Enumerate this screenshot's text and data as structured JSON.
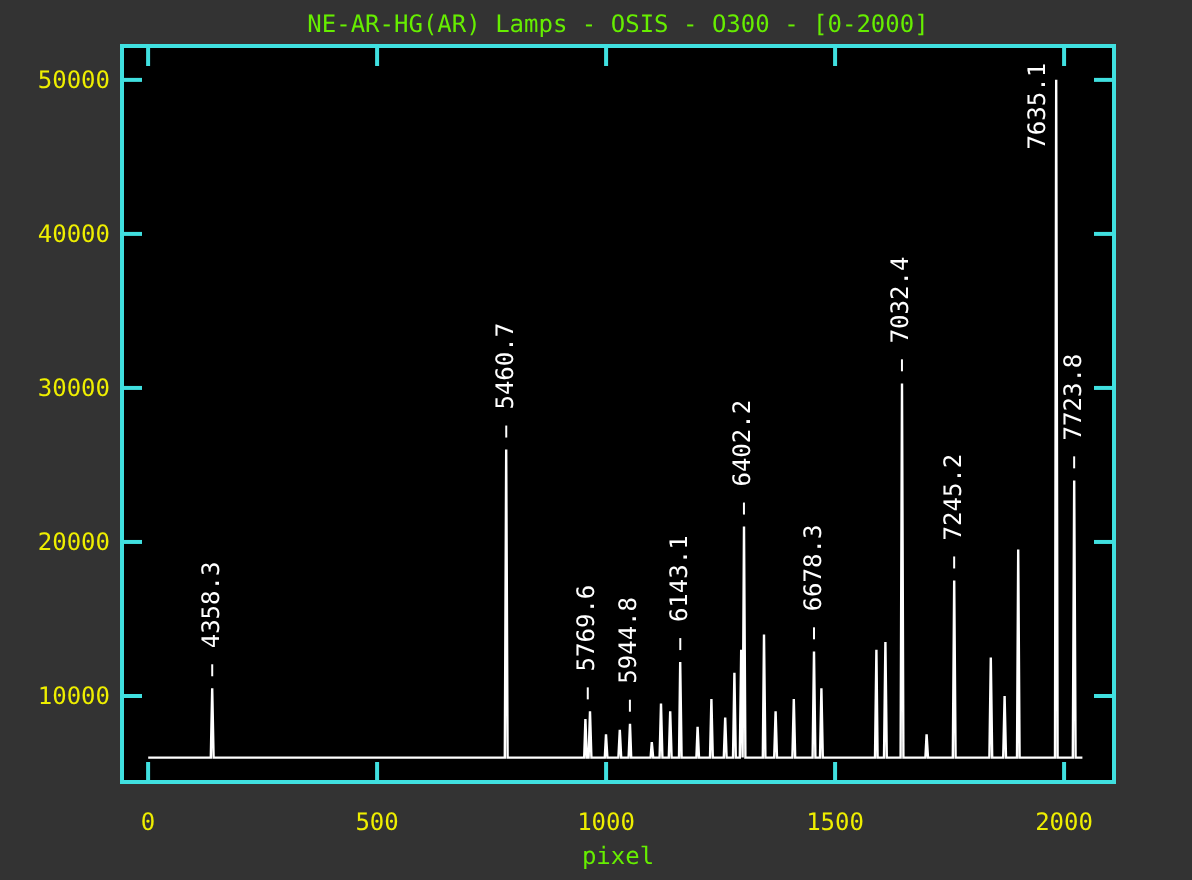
{
  "chart": {
    "chart_data": {
      "type": "line",
      "title": "NE-AR-HG(AR) Lamps - OSIS - O300 - [0-2000]",
      "xlabel": "pixel",
      "xlim": [
        -57,
        2109
      ],
      "ylim": [
        4415,
        52200
      ],
      "xticks": [
        0,
        500,
        1000,
        1500,
        2000
      ],
      "yticks": [
        10000,
        20000,
        30000,
        40000,
        50000
      ],
      "x": [
        0,
        137,
        140,
        143,
        779,
        782,
        785,
        952,
        955,
        958,
        962,
        965,
        968,
        997,
        1000,
        1003,
        1027,
        1030,
        1033,
        1049,
        1052,
        1055,
        1097,
        1100,
        1103,
        1117,
        1120,
        1123,
        1137,
        1140,
        1143,
        1159,
        1162,
        1165,
        1197,
        1200,
        1203,
        1227,
        1230,
        1233,
        1257,
        1260,
        1263,
        1277,
        1280,
        1283,
        1292,
        1295,
        1298,
        1301,
        1304,
        1342,
        1345,
        1348,
        1367,
        1370,
        1373,
        1407,
        1410,
        1413,
        1451,
        1454,
        1457,
        1467,
        1470,
        1473,
        1587,
        1590,
        1593,
        1607,
        1610,
        1613,
        1643,
        1646,
        1649,
        1697,
        1700,
        1703,
        1757,
        1760,
        1763,
        1837,
        1840,
        1843,
        1867,
        1870,
        1873,
        1897,
        1900,
        1903,
        1980,
        1983,
        1986,
        2019,
        2022,
        2025,
        2040
      ],
      "series": [
        {
          "color": "#ffffff",
          "values": [
            6000,
            6000,
            10500,
            6000,
            6000,
            26000,
            6000,
            6000,
            8500,
            6000,
            6000,
            9000,
            6000,
            6000,
            7500,
            6000,
            6000,
            7800,
            6000,
            6000,
            8200,
            6000,
            6000,
            7000,
            6000,
            6000,
            9500,
            6000,
            6000,
            9000,
            6000,
            6000,
            12200,
            6000,
            6000,
            8000,
            6000,
            6000,
            9800,
            6000,
            6000,
            8600,
            6000,
            6000,
            11500,
            6000,
            6000,
            13000,
            6000,
            21000,
            6000,
            6000,
            14000,
            6000,
            6000,
            9000,
            6000,
            6000,
            9800,
            6000,
            6000,
            12900,
            6000,
            6000,
            10500,
            6000,
            6000,
            13000,
            6000,
            6000,
            13500,
            6000,
            6000,
            30300,
            6000,
            6000,
            7500,
            6000,
            6000,
            17500,
            6000,
            6000,
            12500,
            6000,
            6000,
            10000,
            6000,
            6000,
            19500,
            6000,
            6000,
            50000,
            6000,
            6000,
            24000,
            6000,
            6000
          ]
        }
      ],
      "annotations": [
        {
          "x": 140,
          "y": 10500,
          "text": "4358.3"
        },
        {
          "x": 782,
          "y": 26000,
          "text": "5460.7"
        },
        {
          "x": 960,
          "y": 9000,
          "text": "5769.6"
        },
        {
          "x": 1052,
          "y": 8200,
          "text": "5944.8"
        },
        {
          "x": 1162,
          "y": 12200,
          "text": "6143.1"
        },
        {
          "x": 1301,
          "y": 21000,
          "text": "6402.2"
        },
        {
          "x": 1454,
          "y": 12900,
          "text": "6678.3"
        },
        {
          "x": 1646,
          "y": 30300,
          "text": "7032.4"
        },
        {
          "x": 1760,
          "y": 17500,
          "text": "7245.2"
        },
        {
          "x": 1983,
          "y": 50000,
          "text": "7635.1"
        },
        {
          "x": 2022,
          "y": 24000,
          "text": "7723.8"
        }
      ]
    }
  }
}
